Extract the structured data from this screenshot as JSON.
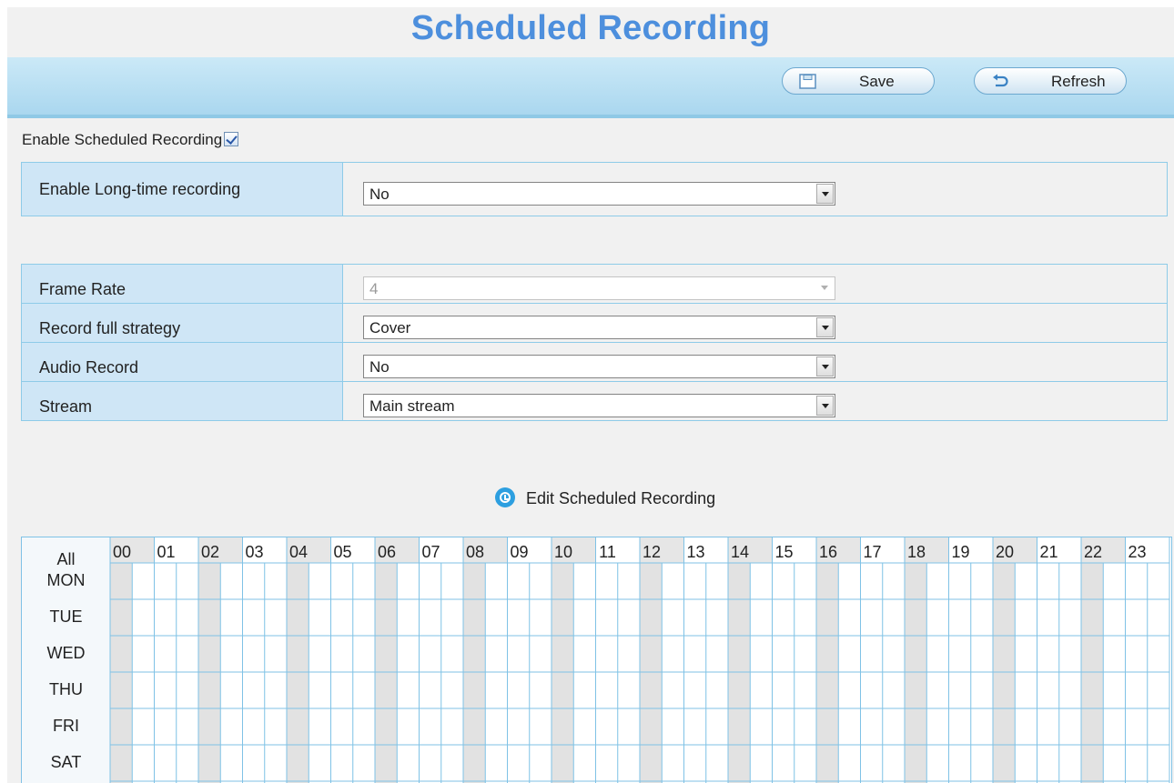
{
  "title": "Scheduled Recording",
  "toolbar": {
    "save_label": "Save",
    "refresh_label": "Refresh"
  },
  "enable_scheduled": {
    "label": "Enable Scheduled Recording",
    "checked": true
  },
  "fields": {
    "long_time": {
      "label": "Enable Long-time recording",
      "value": "No"
    },
    "frame_rate": {
      "label": "Frame Rate",
      "value": "4",
      "disabled": true
    },
    "full_strategy": {
      "label": "Record full strategy",
      "value": "Cover"
    },
    "audio": {
      "label": "Audio Record",
      "value": "No"
    },
    "stream": {
      "label": "Stream",
      "value": "Main stream"
    }
  },
  "edit_link": "Edit Scheduled Recording",
  "schedule": {
    "all_label": "All",
    "days": [
      "MON",
      "TUE",
      "WED",
      "THU",
      "FRI",
      "SAT"
    ],
    "hours": [
      "00",
      "01",
      "02",
      "03",
      "04",
      "05",
      "06",
      "07",
      "08",
      "09",
      "10",
      "11",
      "12",
      "13",
      "14",
      "15",
      "16",
      "17",
      "18",
      "19",
      "20",
      "21",
      "22",
      "23"
    ]
  },
  "colors": {
    "accent": "#4d8fdd",
    "grid_line": "#7fc2e6",
    "shaded": "#e2e2e2",
    "label_bg": "#cfe6f6"
  }
}
